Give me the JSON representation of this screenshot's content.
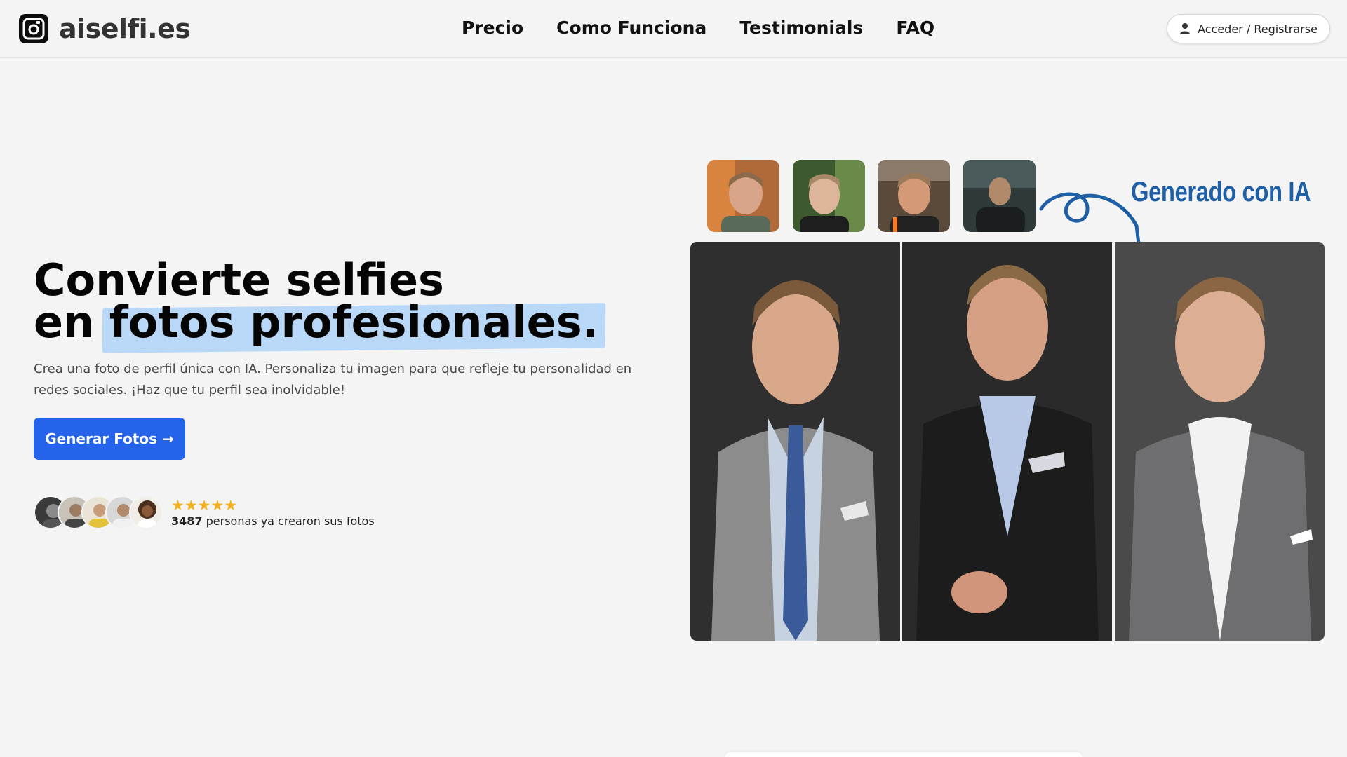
{
  "brand": {
    "name": "aiselfi.es",
    "logo_icon": "camera-refresh-icon"
  },
  "nav": {
    "items": [
      {
        "label": "Precio"
      },
      {
        "label": "Como Funciona"
      },
      {
        "label": "Testimonials"
      },
      {
        "label": "FAQ"
      }
    ]
  },
  "login": {
    "label": "Acceder / Registrarse",
    "icon": "user-icon"
  },
  "hero": {
    "headline_line1": "Convierte selfies",
    "headline_line2_prefix": "en",
    "headline_line2_highlight": "fotos profesionales.",
    "subtext": "Crea una foto de perfil única con IA. Personaliza tu imagen para que refleje tu personalidad en redes sociales. ¡Haz que tu perfil sea inolvidable!",
    "cta_label": "Generar Fotos →",
    "rating_stars": 5,
    "users_count": "3487",
    "users_text": " personas ya crearon sus fotos",
    "generated_label": "Generado con IA"
  },
  "colors": {
    "accent": "#2563eb",
    "highlight": "#b9d8f7",
    "star": "#f2b01e",
    "annotation": "#1f5fa6"
  }
}
